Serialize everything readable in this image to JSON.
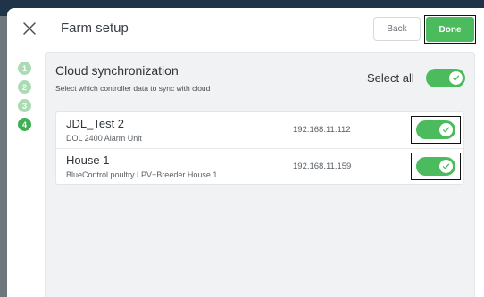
{
  "header": {
    "title": "Farm setup",
    "back_label": "Back",
    "done_label": "Done"
  },
  "steps": [
    "1",
    "2",
    "3",
    "4"
  ],
  "active_step": "4",
  "sync": {
    "title": "Cloud synchronization",
    "subtitle": "Select which controller data to sync with cloud",
    "select_all_label": "Select all",
    "select_all_on": true
  },
  "controllers": [
    {
      "name": "JDL_Test 2",
      "description": "DOL 2400 Alarm Unit",
      "ip": "192.168.11.112",
      "enabled": true
    },
    {
      "name": "House 1",
      "description": "BlueControl poultry LPV+Breeder House 1",
      "ip": "192.168.11.159",
      "enabled": true
    }
  ],
  "colors": {
    "accent": "#4cbb5e",
    "step_active": "#3fae54",
    "step_done": "#a9dcb2"
  },
  "icons": {
    "close": "close-icon",
    "check": "check-icon"
  }
}
